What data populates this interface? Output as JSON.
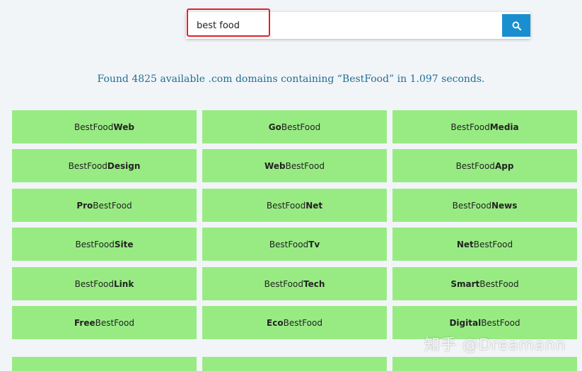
{
  "search": {
    "value": "best food"
  },
  "results": {
    "summary": "Found 4825 available .com domains containing “BestFood” in 1.097 seconds."
  },
  "domains": [
    {
      "pre": "",
      "bold": "",
      "post": "BestFood",
      "suffix": "Web"
    },
    {
      "pre": "Go",
      "post": "BestFood"
    },
    {
      "pre": "",
      "post": "BestFood",
      "suffix": "Media"
    },
    {
      "pre": "",
      "post": "BestFood",
      "suffix": "Design"
    },
    {
      "pre": "Web",
      "post": "BestFood"
    },
    {
      "pre": "",
      "post": "BestFood",
      "suffix": "App"
    },
    {
      "pre": "Pro",
      "post": "BestFood"
    },
    {
      "pre": "",
      "post": "BestFood",
      "suffix": "Net"
    },
    {
      "pre": "",
      "post": "BestFood",
      "suffix": "News"
    },
    {
      "pre": "",
      "post": "BestFood",
      "suffix": "Site"
    },
    {
      "pre": "",
      "post": "BestFood",
      "suffix": "Tv"
    },
    {
      "pre": "Net",
      "post": "BestFood"
    },
    {
      "pre": "",
      "post": "BestFood",
      "suffix": "Link"
    },
    {
      "pre": "",
      "post": "BestFood",
      "suffix": "Tech"
    },
    {
      "pre": "Smart",
      "post": "BestFood"
    },
    {
      "pre": "Free",
      "post": "BestFood"
    },
    {
      "pre": "Eco",
      "post": "BestFood"
    },
    {
      "pre": "Digital",
      "post": "BestFood"
    },
    {
      "pre": "",
      "post": ""
    },
    {
      "pre": "",
      "post": ""
    },
    {
      "pre": "",
      "post": ""
    }
  ],
  "watermark": "知乎 @Dreamann",
  "colors": {
    "tile": "#98eb83",
    "accent": "#1a8fcf",
    "result_text": "#1f6e96",
    "highlight": "#e0202a"
  },
  "icons": {
    "search_button": "search-icon"
  }
}
